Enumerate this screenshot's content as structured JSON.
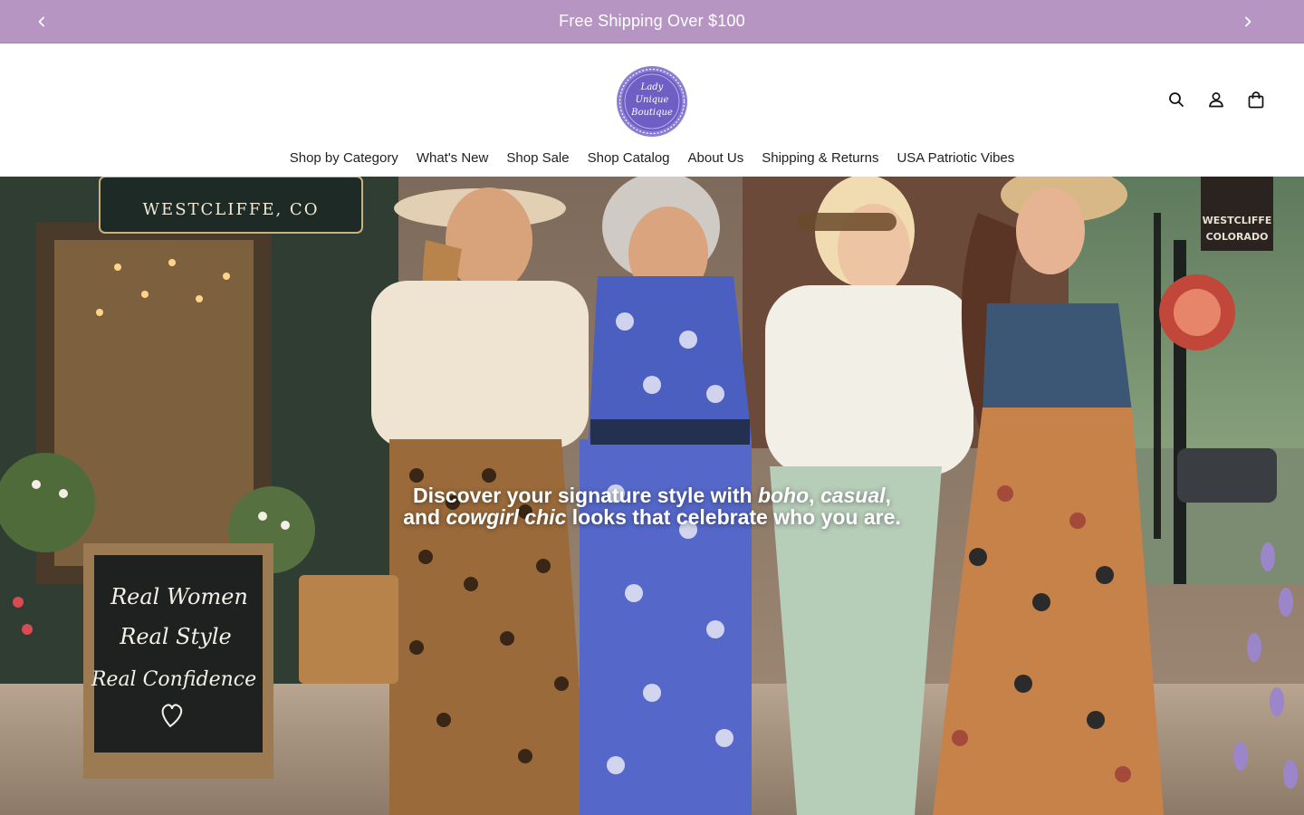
{
  "announcement": {
    "text": "Free Shipping Over $100",
    "prev_icon": "chevron-left-icon",
    "next_icon": "chevron-right-icon"
  },
  "brand": {
    "logo_line1": "Lady",
    "logo_line2": "Unique",
    "logo_line3": "Boutique",
    "logo_color": "#6f5fc4"
  },
  "header_icons": [
    "search-icon",
    "account-icon",
    "cart-icon"
  ],
  "nav": {
    "items": [
      {
        "label": "Shop by Category"
      },
      {
        "label": "What's New"
      },
      {
        "label": "Shop Sale"
      },
      {
        "label": "Shop Catalog"
      },
      {
        "label": "About Us"
      },
      {
        "label": "Shipping & Returns"
      },
      {
        "label": "USA Patriotic Vibes"
      }
    ]
  },
  "hero": {
    "line1_a": "Discover your signature style with ",
    "line1_b": "boho",
    "line1_c": ", ",
    "line1_d": "casual",
    "line1_e": ",",
    "line2_a": "and ",
    "line2_b": "cowgirl chic",
    "line2_c": " looks that celebrate who you are.",
    "store_sign": "WESTCLIFFE, CO",
    "banner_sign_1": "WESTCLIFFE",
    "banner_sign_2": "COLORADO",
    "chalk_1": "Real Women",
    "chalk_2": "Real Style",
    "chalk_3": "Real Confidence"
  },
  "colors": {
    "announcement_bg": "#b795c3",
    "text": "#222222"
  }
}
